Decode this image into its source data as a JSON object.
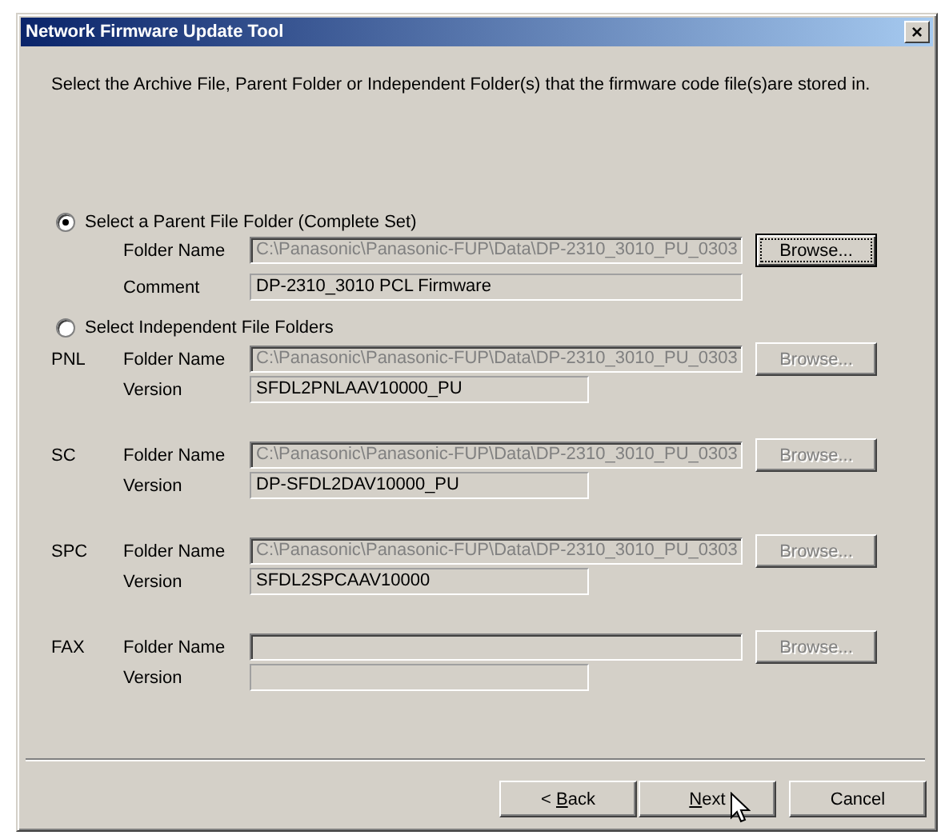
{
  "window": {
    "title": "Network Firmware Update Tool",
    "close": "×"
  },
  "instruction": "Select the Archive File, Parent Folder or Independent Folder(s) that the firmware code file(s)are stored in.",
  "parent_option": {
    "label": "Select a Parent File Folder (Complete Set)",
    "selected": true,
    "folder_label": "Folder Name",
    "folder_value": "C:\\Panasonic\\Panasonic-FUP\\Data\\DP-2310_3010_PU_0303",
    "folder_disabled": true,
    "browse": {
      "label": "Browse...",
      "disabled": false,
      "focused": true
    },
    "comment_label": "Comment",
    "comment_value": "DP-2310_3010 PCL Firmware"
  },
  "independent_option": {
    "label": "Select Independent File Folders",
    "selected": false,
    "modules": [
      {
        "code": "PNL",
        "folder_label": "Folder Name",
        "folder_value": "C:\\Panasonic\\Panasonic-FUP\\Data\\DP-2310_3010_PU_0303",
        "folder_disabled": true,
        "browse": {
          "label": "Browse...",
          "disabled": true
        },
        "version_label": "Version",
        "version_value": "SFDL2PNLAAV10000_PU"
      },
      {
        "code": "SC",
        "folder_label": "Folder Name",
        "folder_value": "C:\\Panasonic\\Panasonic-FUP\\Data\\DP-2310_3010_PU_0303",
        "folder_disabled": true,
        "browse": {
          "label": "Browse...",
          "disabled": true
        },
        "version_label": "Version",
        "version_value": "DP-SFDL2DAV10000_PU"
      },
      {
        "code": "SPC",
        "folder_label": "Folder Name",
        "folder_value": "C:\\Panasonic\\Panasonic-FUP\\Data\\DP-2310_3010_PU_0303",
        "folder_disabled": true,
        "browse": {
          "label": "Browse...",
          "disabled": true
        },
        "version_label": "Version",
        "version_value": "SFDL2SPCAAV10000"
      },
      {
        "code": "FAX",
        "folder_label": "Folder Name",
        "folder_disabled": true,
        "browse": {
          "label": "Browse...",
          "disabled": true
        },
        "version_label": "Version"
      }
    ]
  },
  "buttons": [
    {
      "kind": "back",
      "before": "< ",
      "key": "B",
      "after": "ack"
    },
    {
      "kind": "next",
      "key": "N",
      "after": "ext"
    },
    {
      "kind": "cancel",
      "before": "Cancel"
    }
  ]
}
